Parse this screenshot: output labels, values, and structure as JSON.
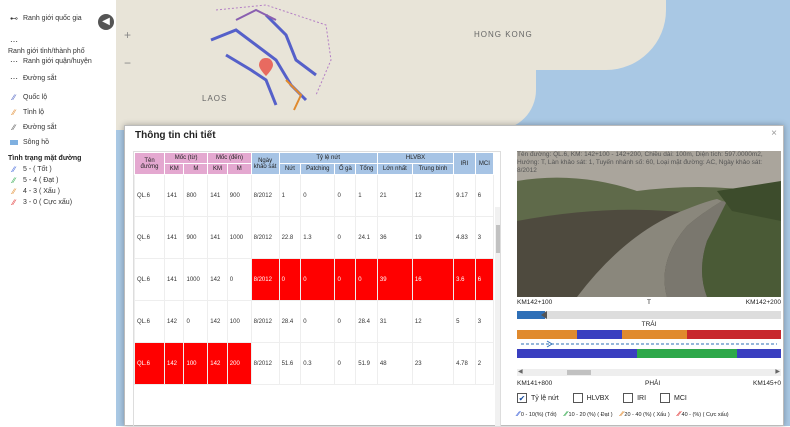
{
  "legend": {
    "boundary_items": [
      {
        "icon": "national-boundary",
        "label": "Ranh giới quốc gia"
      },
      {
        "icon": "provincial-boundary",
        "label": "Ranh giới tỉnh/thành phố"
      },
      {
        "icon": "district-boundary",
        "label": "Ranh giới quận/huyện"
      },
      {
        "icon": "railway",
        "label": "Đường sắt"
      }
    ],
    "road_items": [
      {
        "label": "Quốc lộ",
        "color": "#4a5fc1"
      },
      {
        "label": "Tỉnh lộ",
        "color": "#e08a2e"
      },
      {
        "label": "Đường sắt",
        "color": "#555555"
      },
      {
        "label": "Sông hồ",
        "color": "#7fb0e0"
      }
    ],
    "condition_title": "Tình trạng mặt đường",
    "condition_items": [
      {
        "label": "5 - ( Tốt )",
        "color": "#3a5fd8"
      },
      {
        "label": "5 - 4 ( Đạt )",
        "color": "#2ea84a"
      },
      {
        "label": "4 - 3 ( Xấu )",
        "color": "#e08a2e"
      },
      {
        "label": "3 - 0 ( Cực xấu)",
        "color": "#e03030"
      }
    ]
  },
  "map": {
    "labels": {
      "laos": "LAOS",
      "hongkong": "HONG KONG"
    }
  },
  "modal": {
    "title": "Thông tin chi tiết",
    "close": "×",
    "table": {
      "headers": {
        "ten_duong": "Tên đường",
        "moc_tu": "Mốc (từ)",
        "moc_den": "Mốc (đến)",
        "ngay_khao_sat": "Ngày khảo sát",
        "ty_le_nut": "Tỷ lệ nứt",
        "hlvbx": "HLVBX",
        "iri": "IRI",
        "mci": "MCI",
        "km": "KM",
        "m": "M",
        "nut": "Nứt",
        "patching": "Patching",
        "o_ga": "Ổ gà",
        "tong": "Tổng",
        "lon_nhat": "Lớn nhất",
        "trung_binh": "Trung bình"
      },
      "rows": [
        [
          "QL.6",
          "141",
          "800",
          "141",
          "900",
          "8/2012",
          "1",
          "0",
          "0",
          "1",
          "21",
          "12",
          "9.17",
          "6"
        ],
        [
          "QL.6",
          "141",
          "900",
          "141",
          "1000",
          "8/2012",
          "22.8",
          "1.3",
          "0",
          "24.1",
          "36",
          "19",
          "4.83",
          "3"
        ],
        [
          "QL.6",
          "141",
          "1000",
          "142",
          "0",
          "8/2012",
          "0",
          "0",
          "0",
          "0",
          "39",
          "16",
          "3.6",
          "6"
        ],
        [
          "QL.6",
          "142",
          "0",
          "142",
          "100",
          "8/2012",
          "28.4",
          "0",
          "0",
          "28.4",
          "31",
          "12",
          "5",
          "3"
        ],
        [
          "QL.6",
          "142",
          "100",
          "142",
          "200",
          "8/2012",
          "51.6",
          "0.3",
          "0",
          "51.9",
          "48",
          "23",
          "4.78",
          "2"
        ]
      ]
    },
    "info": {
      "text": "Tên đường: QL.6, KM: 142+100 - 142+200, Chiều dài: 100m, Diện tích: 597.0000m2, Hướng: T, Làn khảo sát: 1, Tuyến nhánh số: 60, Loại mặt đường: AC, Ngày khảo sát: 8/2012"
    },
    "km_top": {
      "left": "KM142+100",
      "mid": "T",
      "right": "KM142+200"
    },
    "lane_label": "TRÁI",
    "km_bottom": {
      "left": "KM141+800",
      "mid": "PHẢI",
      "right": "KM145+0"
    },
    "checkboxes": [
      {
        "label": "Tỷ lệ nứt",
        "checked": "✔"
      },
      {
        "label": "HLVBX",
        "checked": ""
      },
      {
        "label": "IRI",
        "checked": ""
      },
      {
        "label": "MCI",
        "checked": ""
      }
    ],
    "color_legend": [
      {
        "label": "0 - 10(%) (Tốt)",
        "color": "#3a5fd8"
      },
      {
        "label": "10 - 20 (%) ( Đạt )",
        "color": "#2ea84a"
      },
      {
        "label": "20 - 40 (%) ( Xấu )",
        "color": "#e08a2e"
      },
      {
        "label": "40 - (%) ( Cực xấu)",
        "color": "#e03030"
      }
    ]
  }
}
